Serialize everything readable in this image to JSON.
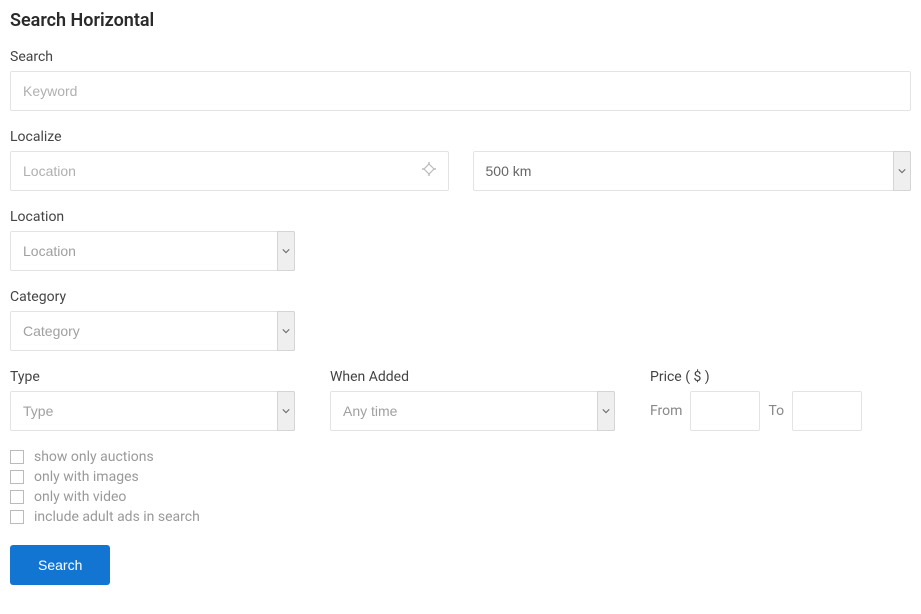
{
  "title": "Search Horizontal",
  "search": {
    "label": "Search",
    "placeholder": "Keyword"
  },
  "localize": {
    "label": "Localize",
    "placeholder": "Location",
    "distance_selected": "500 km"
  },
  "location": {
    "label": "Location",
    "placeholder": "Location"
  },
  "category": {
    "label": "Category",
    "placeholder": "Category"
  },
  "type": {
    "label": "Type",
    "placeholder": "Type"
  },
  "when_added": {
    "label": "When Added",
    "placeholder": "Any time"
  },
  "price": {
    "label": "Price ( $ )",
    "from_label": "From",
    "to_label": "To"
  },
  "checkboxes": {
    "auctions": "show only auctions",
    "images": "only with images",
    "video": "only with video",
    "adult": "include adult ads in search"
  },
  "submit": "Search"
}
